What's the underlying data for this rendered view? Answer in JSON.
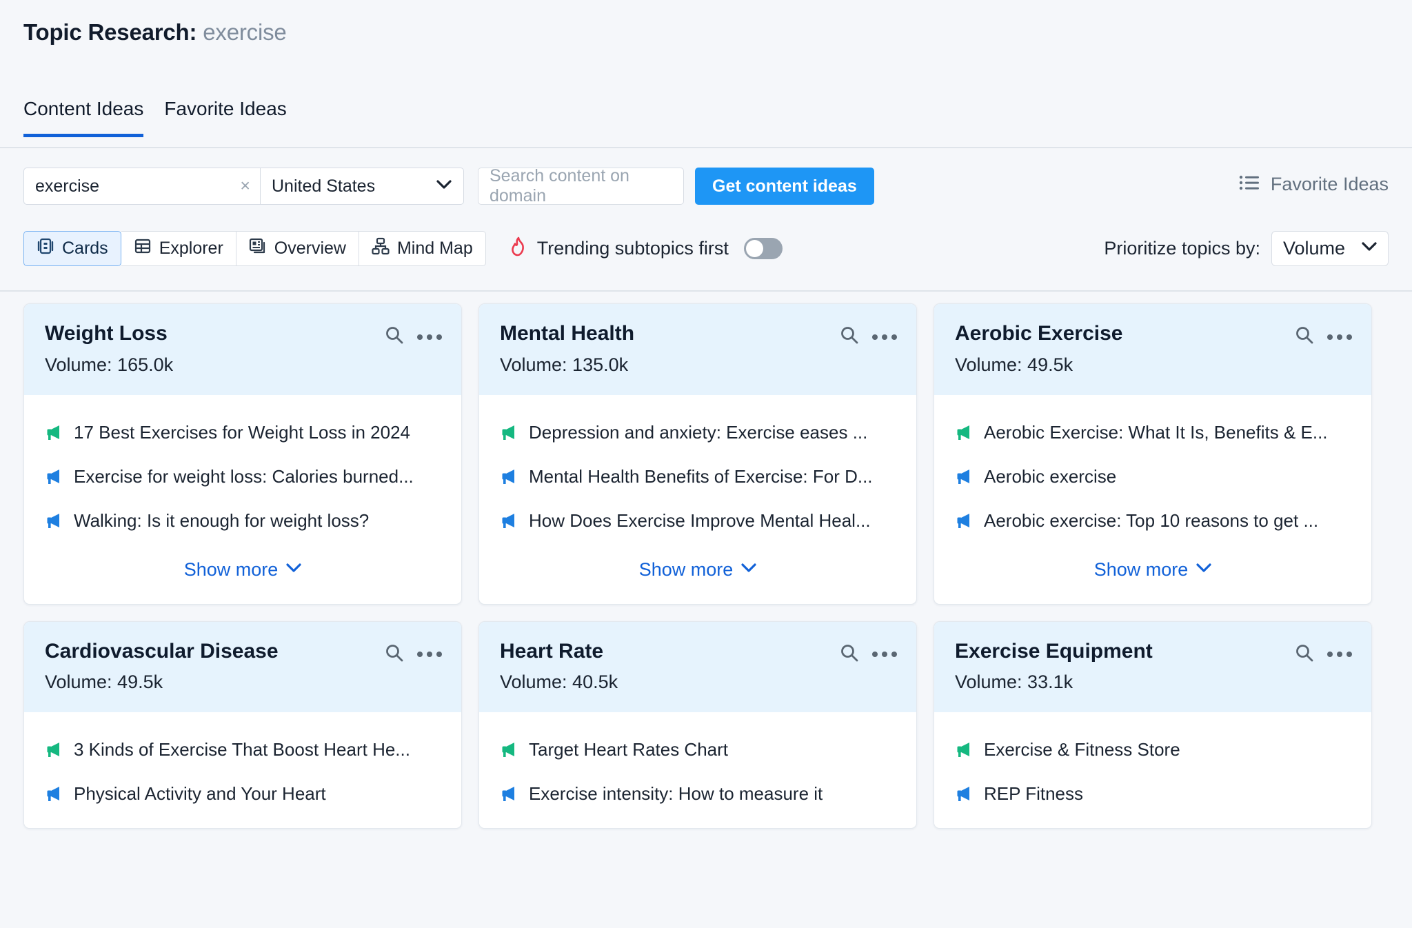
{
  "header": {
    "title_prefix": "Topic Research:",
    "query": "exercise"
  },
  "tabs": [
    {
      "label": "Content Ideas",
      "active": true
    },
    {
      "label": "Favorite Ideas",
      "active": false
    }
  ],
  "filters": {
    "keyword_value": "exercise",
    "keyword_clear": "×",
    "country": "United States",
    "domain_placeholder": "Search content on domain",
    "cta_label": "Get content ideas",
    "favorite_ideas_label": "Favorite Ideas"
  },
  "views": [
    {
      "label": "Cards",
      "icon": "cards-icon",
      "active": true
    },
    {
      "label": "Explorer",
      "icon": "table-icon",
      "active": false
    },
    {
      "label": "Overview",
      "icon": "overview-icon",
      "active": false
    },
    {
      "label": "Mind Map",
      "icon": "mindmap-icon",
      "active": false
    }
  ],
  "trending": {
    "label": "Trending subtopics first",
    "enabled": false
  },
  "prioritize": {
    "label": "Prioritize topics by:",
    "value": "Volume"
  },
  "show_more_label": "Show more",
  "colors": {
    "accent": "#1e96f5",
    "link": "#1161d8",
    "card_head": "#e6f3fd",
    "flame": "#eb3a4e",
    "mega_green": "#15b880",
    "mega_blue": "#1e7fe0"
  },
  "cards": [
    {
      "title": "Weight Loss",
      "volume": "Volume: 165.0k",
      "show_more": true,
      "ideas": [
        {
          "text": "17 Best Exercises for Weight Loss in 2024",
          "color": "green"
        },
        {
          "text": "Exercise for weight loss: Calories burned...",
          "color": "blue"
        },
        {
          "text": "Walking: Is it enough for weight loss?",
          "color": "blue"
        }
      ]
    },
    {
      "title": "Mental Health",
      "volume": "Volume: 135.0k",
      "show_more": true,
      "ideas": [
        {
          "text": "Depression and anxiety: Exercise eases ...",
          "color": "green"
        },
        {
          "text": "Mental Health Benefits of Exercise: For D...",
          "color": "blue"
        },
        {
          "text": "How Does Exercise Improve Mental Heal...",
          "color": "blue"
        }
      ]
    },
    {
      "title": "Aerobic Exercise",
      "volume": "Volume: 49.5k",
      "show_more": true,
      "ideas": [
        {
          "text": "Aerobic Exercise: What It Is, Benefits & E...",
          "color": "green"
        },
        {
          "text": "Aerobic exercise",
          "color": "blue"
        },
        {
          "text": "Aerobic exercise: Top 10 reasons to get ...",
          "color": "blue"
        }
      ]
    },
    {
      "title": "Cardiovascular Disease",
      "volume": "Volume: 49.5k",
      "show_more": false,
      "ideas": [
        {
          "text": "3 Kinds of Exercise That Boost Heart He...",
          "color": "green"
        },
        {
          "text": "Physical Activity and Your Heart",
          "color": "blue"
        }
      ]
    },
    {
      "title": "Heart Rate",
      "volume": "Volume: 40.5k",
      "show_more": false,
      "ideas": [
        {
          "text": "Target Heart Rates Chart",
          "color": "green"
        },
        {
          "text": "Exercise intensity: How to measure it",
          "color": "blue"
        }
      ]
    },
    {
      "title": "Exercise Equipment",
      "volume": "Volume: 33.1k",
      "show_more": false,
      "ideas": [
        {
          "text": "Exercise & Fitness Store",
          "color": "green"
        },
        {
          "text": "REP Fitness",
          "color": "blue"
        }
      ]
    }
  ]
}
